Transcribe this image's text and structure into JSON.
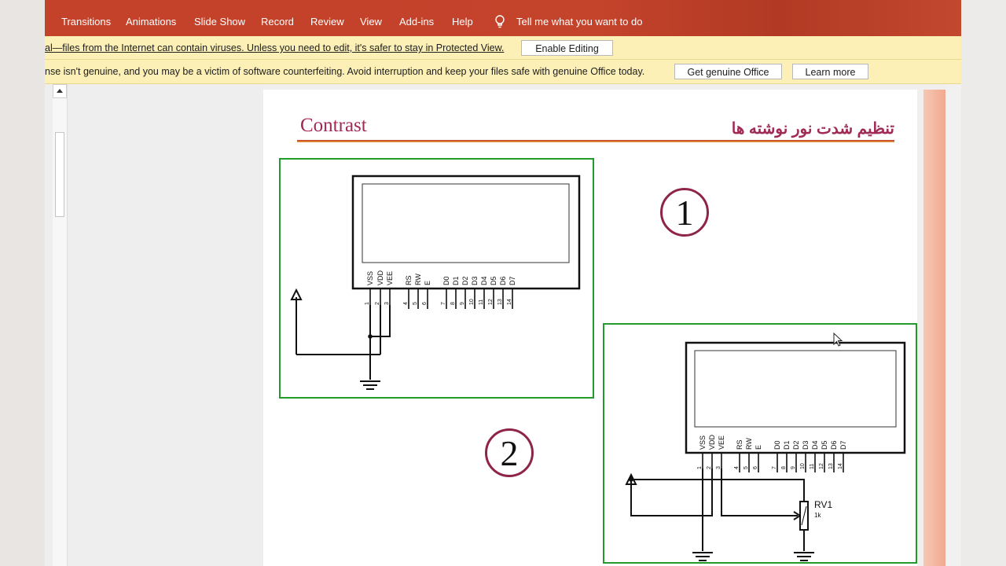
{
  "ribbon": {
    "tabs": [
      "Transitions",
      "Animations",
      "Slide Show",
      "Record",
      "Review",
      "View",
      "Add-ins",
      "Help"
    ],
    "tell_me": "Tell me what you want to do"
  },
  "protected_view_bar": {
    "message": "al—files from the Internet can contain viruses. Unless you need to edit, it's safer to stay in Protected View.",
    "button": "Enable Editing"
  },
  "genuine_bar": {
    "message": "nse isn't genuine, and you may be a victim of software counterfeiting. Avoid interruption and keep your files safe with genuine Office today.",
    "button_get": "Get genuine Office",
    "button_learn": "Learn more"
  },
  "slide": {
    "title": "Contrast",
    "title_fa": "تنظیم شدت نور نوشته ها",
    "number_1": "1",
    "number_2": "2"
  },
  "circuit": {
    "pin_labels": [
      "VSS",
      "VDD",
      "VEE",
      "RS",
      "RW",
      "E",
      "D0",
      "D1",
      "D2",
      "D3",
      "D4",
      "D5",
      "D6",
      "D7"
    ],
    "pin_numbers": [
      "1",
      "2",
      "3",
      "4",
      "5",
      "6",
      "7",
      "8",
      "9",
      "10",
      "11",
      "12",
      "13",
      "14"
    ],
    "resistor_label": "RV1",
    "resistor_value": "1k"
  },
  "icons": [
    "lightbulb-icon",
    "scroll-up-arrow-icon",
    "mouse-cursor-icon"
  ],
  "colors": {
    "ribbon": "#c4412a",
    "message_bar": "#fcf0b7",
    "title": "#a02a56",
    "box_border": "#239a2c"
  }
}
